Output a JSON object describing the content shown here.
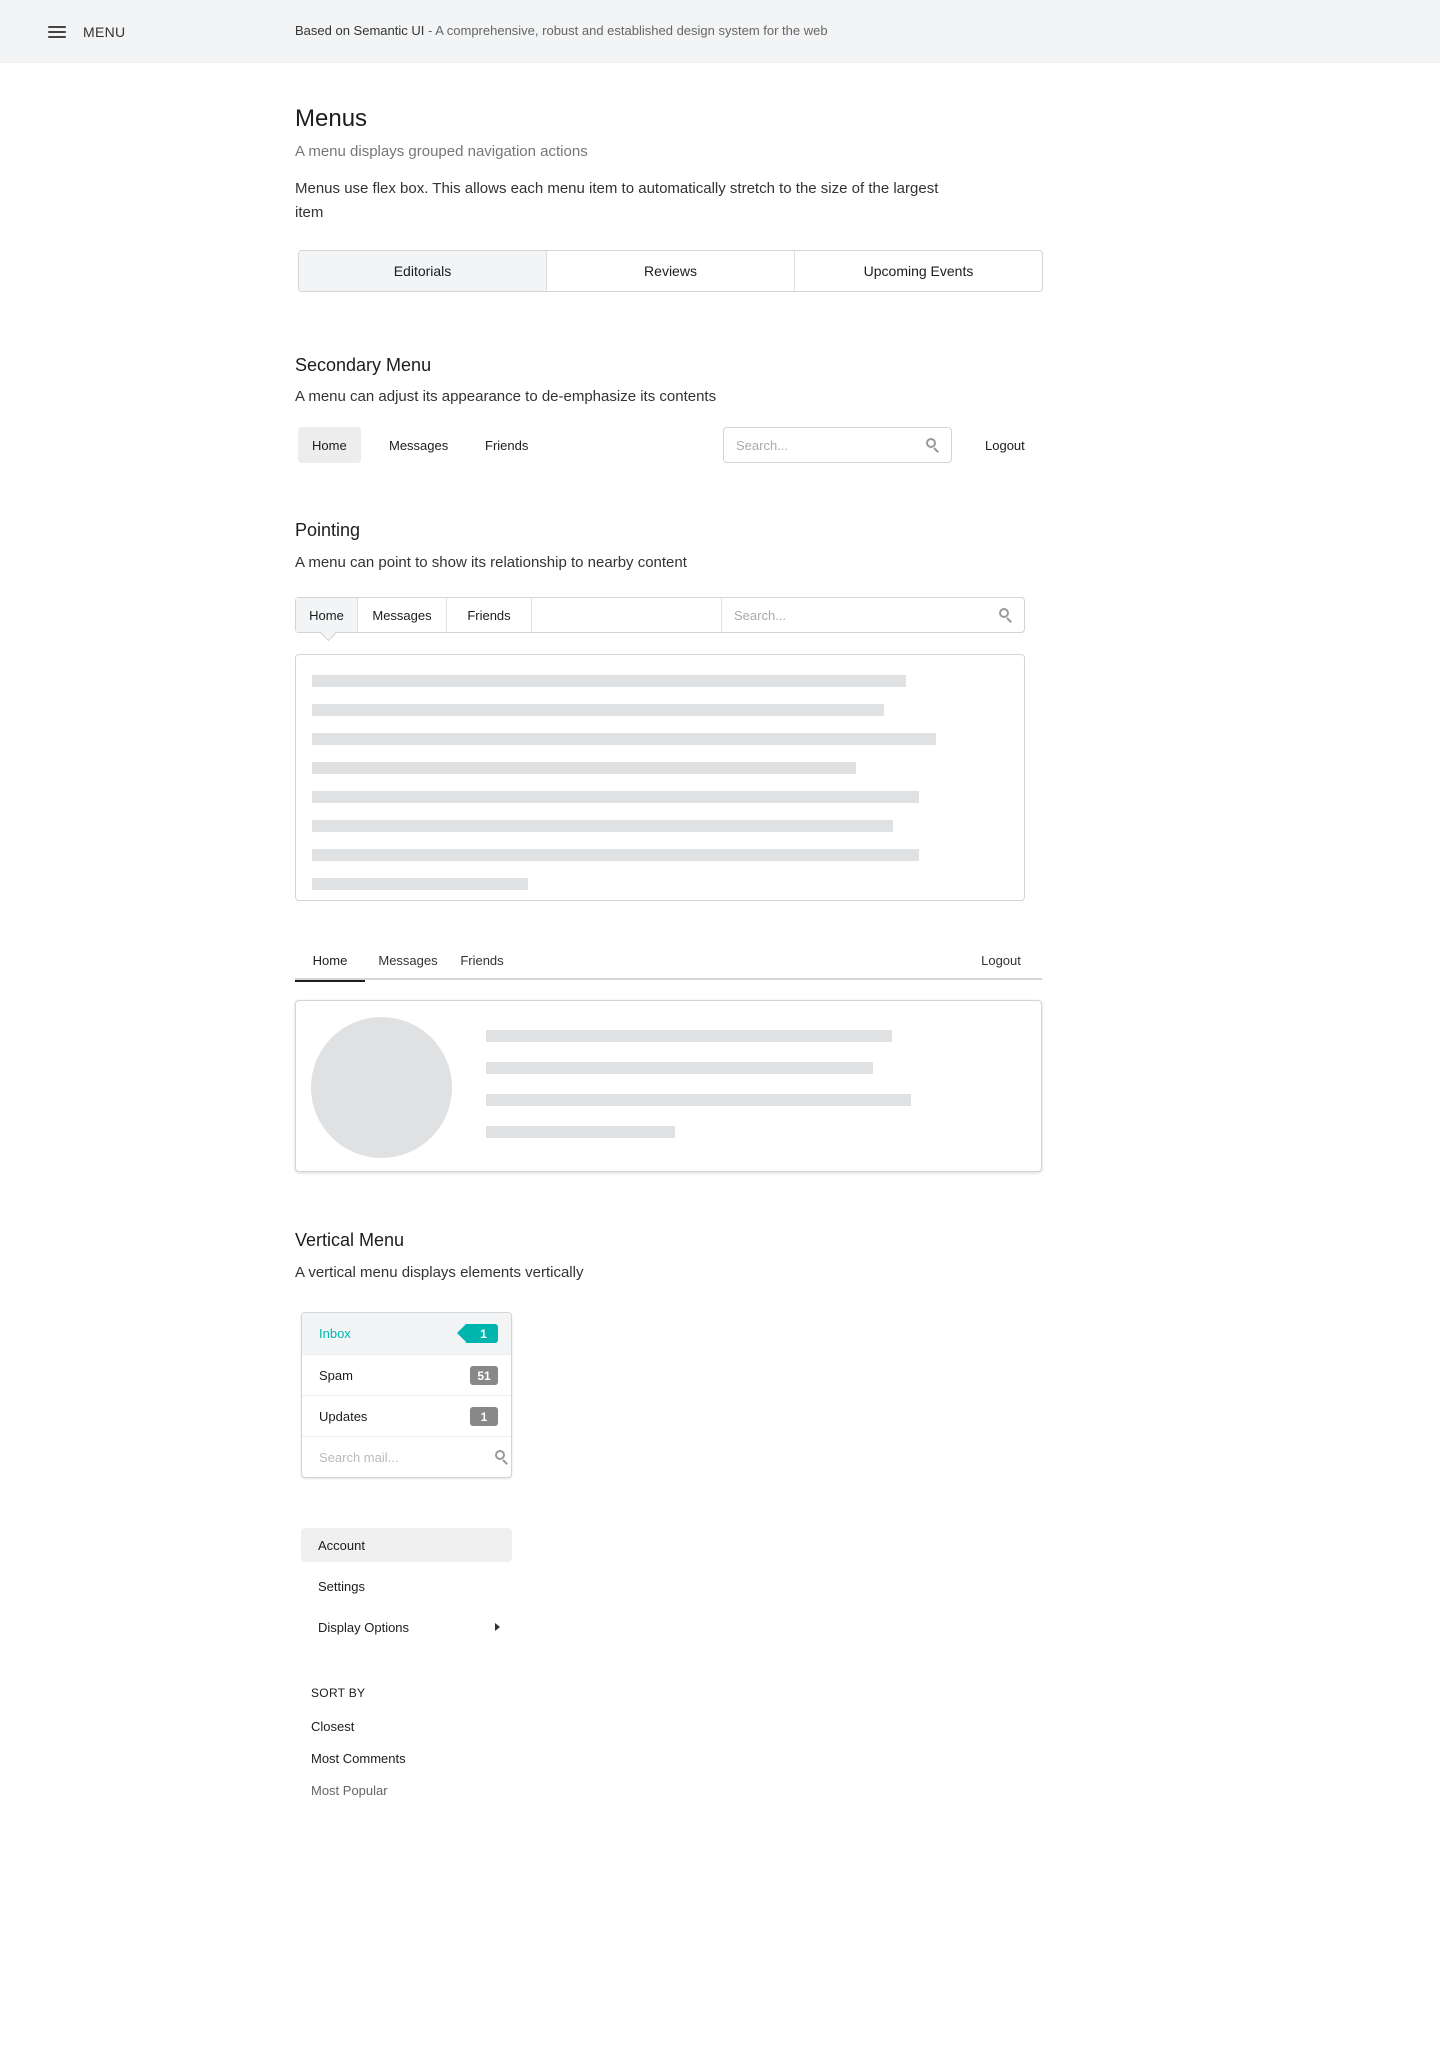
{
  "topbar": {
    "menu_label": "MENU",
    "tagline_brand": "Based on Semantic UI",
    "tagline_rest": " - A comprehensive, robust and established design system for the web"
  },
  "intro": {
    "title": "Menus",
    "subtitle": "A menu displays grouped navigation actions",
    "description": "Menus use flex box. This allows each menu item to automatically stretch to the size of the largest item",
    "items": [
      "Editorials",
      "Reviews",
      "Upcoming Events"
    ]
  },
  "secondary": {
    "title": "Secondary Menu",
    "description": "A menu can adjust its appearance to de-emphasize its contents",
    "items": [
      "Home",
      "Messages",
      "Friends"
    ],
    "search_placeholder": "Search...",
    "logout": "Logout"
  },
  "pointing": {
    "title": "Pointing",
    "description": "A menu can point to show its relationship to nearby content",
    "items": [
      "Home",
      "Messages",
      "Friends"
    ],
    "search_placeholder": "Search..."
  },
  "tabular": {
    "items": [
      "Home",
      "Messages",
      "Friends"
    ],
    "logout": "Logout"
  },
  "vertical": {
    "title": "Vertical Menu",
    "description": "A vertical menu displays elements vertically",
    "mail_items": [
      {
        "label": "Inbox",
        "count": "1"
      },
      {
        "label": "Spam",
        "count": "51"
      },
      {
        "label": "Updates",
        "count": "1"
      }
    ],
    "search_placeholder": "Search mail...",
    "settings_items": [
      "Account",
      "Settings",
      "Display Options"
    ],
    "sort_header": "SORT BY",
    "sort_items": [
      "Closest",
      "Most Comments",
      "Most Popular"
    ]
  },
  "colors": {
    "accent_teal": "#00b5ad",
    "label_grey": "#888888",
    "placeholder_grey": "#e0e1e2",
    "topbar_bg": "#f3f4f5"
  }
}
